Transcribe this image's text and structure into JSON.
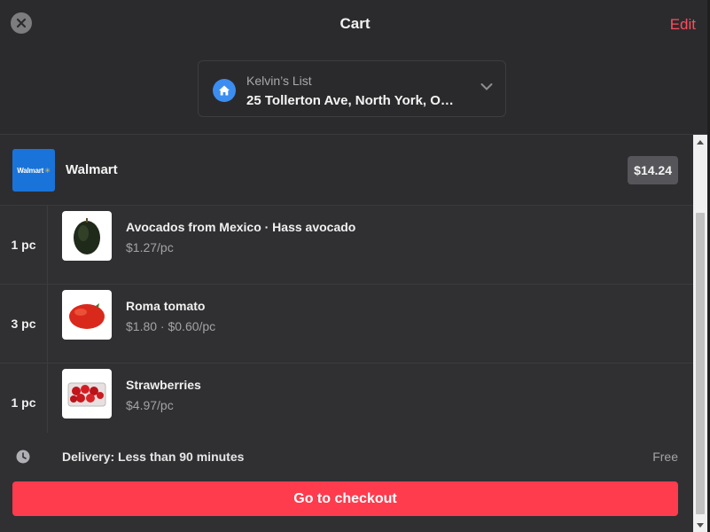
{
  "header": {
    "title": "Cart",
    "edit_label": "Edit",
    "close_icon": "close-icon"
  },
  "list_selector": {
    "name": "Kelvin’s List",
    "address": "25 Tollerton Ave, North York, O…",
    "icon": "home-icon"
  },
  "store": {
    "logo_text": "Walmart",
    "name": "Walmart",
    "total": "$14.24"
  },
  "items": [
    {
      "qty": "1 pc",
      "name": "Avocados from Mexico · Hass avocado",
      "price": "$1.27/pc",
      "image": "avocado"
    },
    {
      "qty": "3 pc",
      "name": "Roma tomato",
      "price": "$1.80 · $0.60/pc",
      "image": "tomato"
    },
    {
      "qty": "1 pc",
      "name": "Strawberries",
      "price": "$4.97/pc",
      "image": "strawberries"
    }
  ],
  "delivery": {
    "text": "Delivery: Less than 90 minutes",
    "fee": "Free",
    "icon": "clock-icon"
  },
  "checkout": {
    "label": "Go to checkout"
  },
  "colors": {
    "accent": "#ff3b4e",
    "edit": "#ff4d5e",
    "home_badge": "#3b8df0",
    "walmart_blue": "#1a73d9"
  }
}
